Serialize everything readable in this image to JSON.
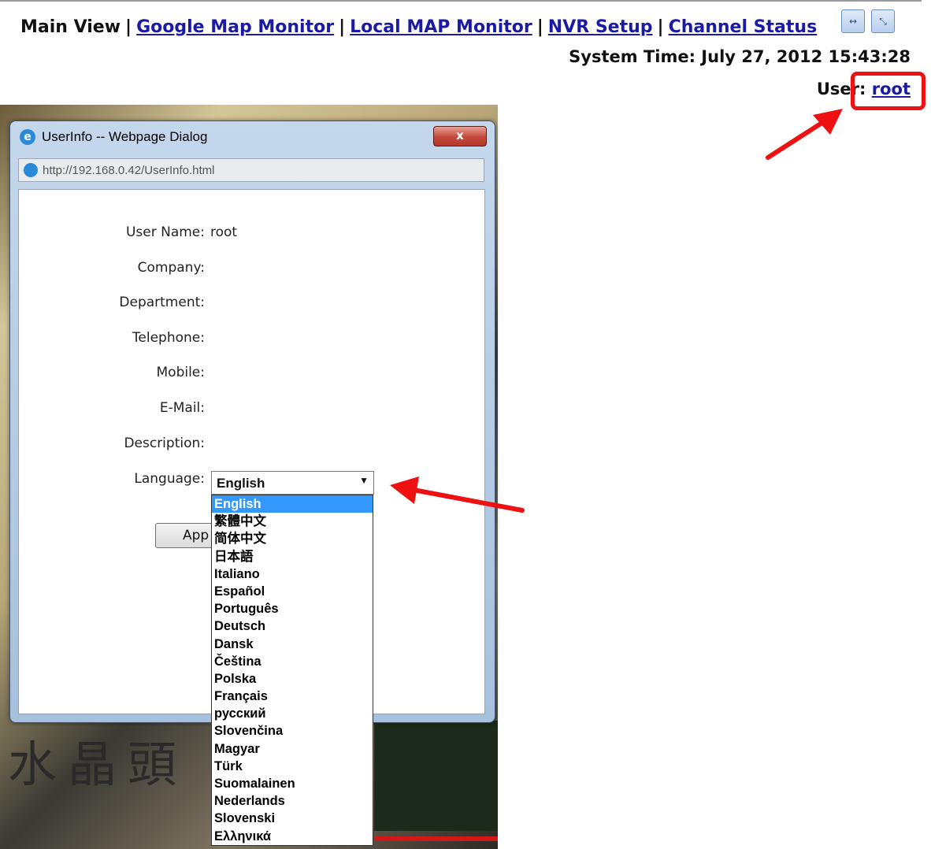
{
  "nav": {
    "main": "Main View",
    "links": [
      "Google Map Monitor",
      "Local MAP Monitor",
      "NVR Setup",
      "Channel Status"
    ],
    "icons": [
      "fit-width-icon",
      "fullscreen-icon"
    ]
  },
  "system_time": "System Time: July 27, 2012 15:43:28",
  "user": {
    "label": "User",
    "sep": ": ",
    "name": "root"
  },
  "dialog": {
    "title": "UserInfo -- Webpage Dialog",
    "close": "x",
    "url": "http://192.168.0.42/UserInfo.html",
    "fields": [
      {
        "label": "User Name:",
        "value": "root"
      },
      {
        "label": "Company:",
        "value": ""
      },
      {
        "label": "Department:",
        "value": ""
      },
      {
        "label": "Telephone:",
        "value": ""
      },
      {
        "label": "Mobile:",
        "value": ""
      },
      {
        "label": "E-Mail:",
        "value": ""
      },
      {
        "label": "Description:",
        "value": ""
      }
    ],
    "language_label": "Language:",
    "language_selected": "English",
    "apply_label": "App",
    "language_options": [
      "English",
      "繁體中文",
      "简体中文",
      "日本語",
      "Italiano",
      "Español",
      "Português",
      "Deutsch",
      "Dansk",
      "Čeština",
      "Polska",
      "Français",
      "русский",
      "Slovenčina",
      "Magyar",
      "Türk",
      "Suomalainen",
      "Nederlands",
      "Slovenski",
      "Ελληνικά"
    ]
  },
  "background_text": "水晶頭",
  "colors": {
    "annotation": "#ee1111",
    "link": "#1a1aa6",
    "selected_option": "#3399ff"
  }
}
